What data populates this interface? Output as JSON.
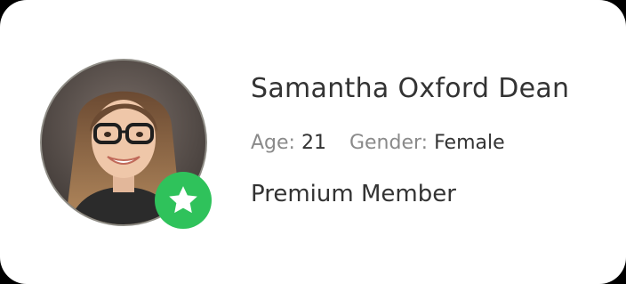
{
  "profile": {
    "name": "Samantha Oxford Dean",
    "age_label": "Age:",
    "age": "21",
    "gender_label": "Gender:",
    "gender": "Female",
    "membership": "Premium Member",
    "badge_icon": "star-icon",
    "badge_color": "#2fc25b"
  }
}
